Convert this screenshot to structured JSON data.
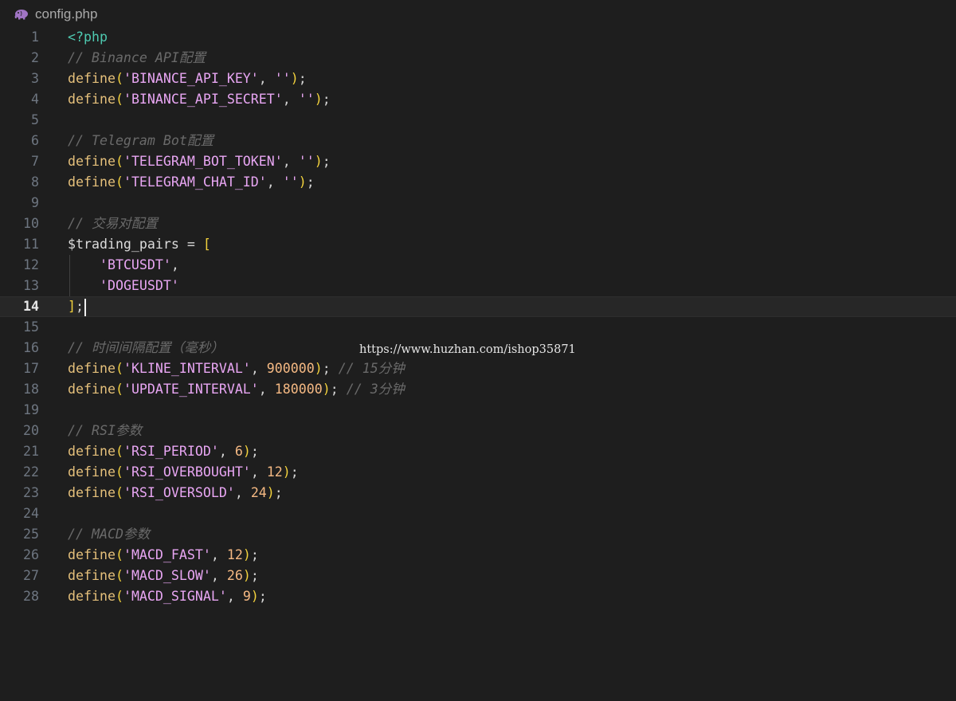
{
  "tab": {
    "icon": "php-elephant-icon",
    "file_name": "config.php"
  },
  "watermark": "https://www.huzhan.com/ishop35871",
  "colors": {
    "background": "#1e1e1e",
    "keyword_define": "#e5c07b",
    "string": "#e8a6f3",
    "number": "#f5b983",
    "comment": "#6a6a6a",
    "php_tag": "#4ec9b0"
  },
  "current_line": 14,
  "lines": [
    {
      "n": "1",
      "tokens": [
        [
          "tag",
          "<?php"
        ]
      ]
    },
    {
      "n": "2",
      "tokens": [
        [
          "comment",
          "// Binance API配置"
        ]
      ]
    },
    {
      "n": "3",
      "tokens": [
        [
          "fn",
          "define"
        ],
        [
          "paren",
          "("
        ],
        [
          "string",
          "'BINANCE_API_KEY'"
        ],
        [
          "punc",
          ", "
        ],
        [
          "string",
          "''"
        ],
        [
          "paren",
          ")"
        ],
        [
          "punc",
          ";"
        ]
      ]
    },
    {
      "n": "4",
      "tokens": [
        [
          "fn",
          "define"
        ],
        [
          "paren",
          "("
        ],
        [
          "string",
          "'BINANCE_API_SECRET'"
        ],
        [
          "punc",
          ", "
        ],
        [
          "string",
          "''"
        ],
        [
          "paren",
          ")"
        ],
        [
          "punc",
          ";"
        ]
      ]
    },
    {
      "n": "5",
      "tokens": []
    },
    {
      "n": "6",
      "tokens": [
        [
          "comment",
          "// Telegram Bot配置"
        ]
      ]
    },
    {
      "n": "7",
      "tokens": [
        [
          "fn",
          "define"
        ],
        [
          "paren",
          "("
        ],
        [
          "string",
          "'TELEGRAM_BOT_TOKEN'"
        ],
        [
          "punc",
          ", "
        ],
        [
          "string",
          "''"
        ],
        [
          "paren",
          ")"
        ],
        [
          "punc",
          ";"
        ]
      ]
    },
    {
      "n": "8",
      "tokens": [
        [
          "fn",
          "define"
        ],
        [
          "paren",
          "("
        ],
        [
          "string",
          "'TELEGRAM_CHAT_ID'"
        ],
        [
          "punc",
          ", "
        ],
        [
          "string",
          "''"
        ],
        [
          "paren",
          ")"
        ],
        [
          "punc",
          ";"
        ]
      ]
    },
    {
      "n": "9",
      "tokens": []
    },
    {
      "n": "10",
      "tokens": [
        [
          "comment",
          "// 交易对配置"
        ]
      ]
    },
    {
      "n": "11",
      "tokens": [
        [
          "var",
          "$trading_pairs"
        ],
        [
          "op",
          " = "
        ],
        [
          "bracket",
          "["
        ]
      ]
    },
    {
      "n": "12",
      "indent": true,
      "tokens": [
        [
          "punc",
          "    "
        ],
        [
          "string",
          "'BTCUSDT'"
        ],
        [
          "punc",
          ","
        ]
      ]
    },
    {
      "n": "13",
      "indent": true,
      "tokens": [
        [
          "punc",
          "    "
        ],
        [
          "string",
          "'DOGEUSDT'"
        ]
      ]
    },
    {
      "n": "14",
      "cursor": true,
      "tokens": [
        [
          "bracket",
          "]"
        ],
        [
          "punc",
          ";"
        ]
      ]
    },
    {
      "n": "15",
      "tokens": []
    },
    {
      "n": "16",
      "tokens": [
        [
          "comment",
          "// 时间间隔配置（毫秒）"
        ]
      ]
    },
    {
      "n": "17",
      "tokens": [
        [
          "fn",
          "define"
        ],
        [
          "paren",
          "("
        ],
        [
          "string",
          "'KLINE_INTERVAL'"
        ],
        [
          "punc",
          ", "
        ],
        [
          "num",
          "900000"
        ],
        [
          "paren",
          ")"
        ],
        [
          "punc",
          "; "
        ],
        [
          "comment",
          "// 15分钟"
        ]
      ]
    },
    {
      "n": "18",
      "tokens": [
        [
          "fn",
          "define"
        ],
        [
          "paren",
          "("
        ],
        [
          "string",
          "'UPDATE_INTERVAL'"
        ],
        [
          "punc",
          ", "
        ],
        [
          "num",
          "180000"
        ],
        [
          "paren",
          ")"
        ],
        [
          "punc",
          "; "
        ],
        [
          "comment",
          "// 3分钟"
        ]
      ]
    },
    {
      "n": "19",
      "tokens": []
    },
    {
      "n": "20",
      "tokens": [
        [
          "comment",
          "// RSI参数"
        ]
      ]
    },
    {
      "n": "21",
      "tokens": [
        [
          "fn",
          "define"
        ],
        [
          "paren",
          "("
        ],
        [
          "string",
          "'RSI_PERIOD'"
        ],
        [
          "punc",
          ", "
        ],
        [
          "num",
          "6"
        ],
        [
          "paren",
          ")"
        ],
        [
          "punc",
          ";"
        ]
      ]
    },
    {
      "n": "22",
      "tokens": [
        [
          "fn",
          "define"
        ],
        [
          "paren",
          "("
        ],
        [
          "string",
          "'RSI_OVERBOUGHT'"
        ],
        [
          "punc",
          ", "
        ],
        [
          "num",
          "12"
        ],
        [
          "paren",
          ")"
        ],
        [
          "punc",
          ";"
        ]
      ]
    },
    {
      "n": "23",
      "tokens": [
        [
          "fn",
          "define"
        ],
        [
          "paren",
          "("
        ],
        [
          "string",
          "'RSI_OVERSOLD'"
        ],
        [
          "punc",
          ", "
        ],
        [
          "num",
          "24"
        ],
        [
          "paren",
          ")"
        ],
        [
          "punc",
          ";"
        ]
      ]
    },
    {
      "n": "24",
      "tokens": []
    },
    {
      "n": "25",
      "tokens": [
        [
          "comment",
          "// MACD参数"
        ]
      ]
    },
    {
      "n": "26",
      "tokens": [
        [
          "fn",
          "define"
        ],
        [
          "paren",
          "("
        ],
        [
          "string",
          "'MACD_FAST'"
        ],
        [
          "punc",
          ", "
        ],
        [
          "num",
          "12"
        ],
        [
          "paren",
          ")"
        ],
        [
          "punc",
          ";"
        ]
      ]
    },
    {
      "n": "27",
      "tokens": [
        [
          "fn",
          "define"
        ],
        [
          "paren",
          "("
        ],
        [
          "string",
          "'MACD_SLOW'"
        ],
        [
          "punc",
          ", "
        ],
        [
          "num",
          "26"
        ],
        [
          "paren",
          ")"
        ],
        [
          "punc",
          ";"
        ]
      ]
    },
    {
      "n": "28",
      "tokens": [
        [
          "fn",
          "define"
        ],
        [
          "paren",
          "("
        ],
        [
          "string",
          "'MACD_SIGNAL'"
        ],
        [
          "punc",
          ", "
        ],
        [
          "num",
          "9"
        ],
        [
          "paren",
          ")"
        ],
        [
          "punc",
          ";"
        ]
      ]
    }
  ]
}
